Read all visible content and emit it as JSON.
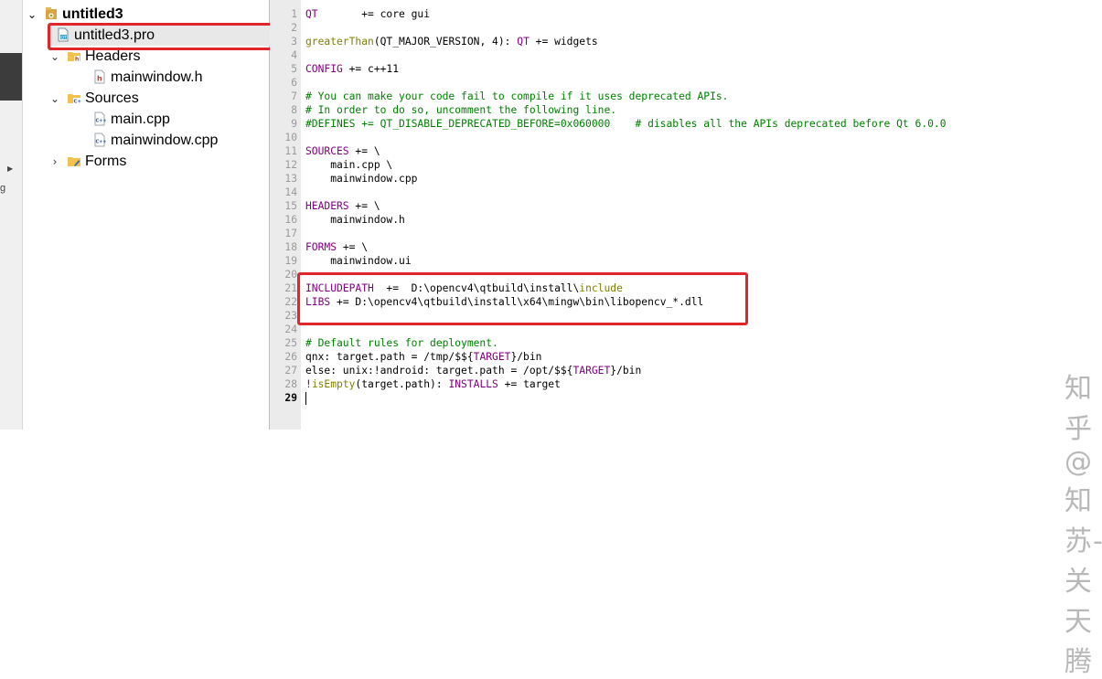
{
  "sidebar": {
    "g_label": "g"
  },
  "project_tree": {
    "root": "untitled3",
    "pro_file": "untitled3.pro",
    "headers_folder": "Headers",
    "header_file": "mainwindow.h",
    "sources_folder": "Sources",
    "source_main": "main.cpp",
    "source_mainwindow": "mainwindow.cpp",
    "forms_folder": "Forms"
  },
  "editor": {
    "lines": [
      {
        "n": "1",
        "segs": [
          {
            "t": "QT",
            "c": "kw"
          },
          {
            "t": "       += core gui"
          }
        ]
      },
      {
        "n": "2",
        "segs": []
      },
      {
        "n": "3",
        "segs": [
          {
            "t": "greaterThan",
            "c": "fn"
          },
          {
            "t": "(QT_MAJOR_VERSION, 4): "
          },
          {
            "t": "QT",
            "c": "kw"
          },
          {
            "t": " += widgets"
          }
        ]
      },
      {
        "n": "4",
        "segs": []
      },
      {
        "n": "5",
        "segs": [
          {
            "t": "CONFIG",
            "c": "kw"
          },
          {
            "t": " += c++11"
          }
        ]
      },
      {
        "n": "6",
        "segs": []
      },
      {
        "n": "7",
        "segs": [
          {
            "t": "# You can make your code fail to compile if it uses deprecated APIs.",
            "c": "cm"
          }
        ]
      },
      {
        "n": "8",
        "segs": [
          {
            "t": "# In order to do so, uncomment the following line.",
            "c": "cm"
          }
        ]
      },
      {
        "n": "9",
        "segs": [
          {
            "t": "#DEFINES += QT_DISABLE_DEPRECATED_BEFORE=0x060000    # disables all the APIs deprecated before Qt 6.0.0",
            "c": "cm"
          }
        ]
      },
      {
        "n": "10",
        "segs": []
      },
      {
        "n": "11",
        "segs": [
          {
            "t": "SOURCES",
            "c": "kw"
          },
          {
            "t": " += \\"
          }
        ]
      },
      {
        "n": "12",
        "segs": [
          {
            "t": "    main.cpp \\"
          }
        ]
      },
      {
        "n": "13",
        "segs": [
          {
            "t": "    mainwindow.cpp"
          }
        ]
      },
      {
        "n": "14",
        "segs": []
      },
      {
        "n": "15",
        "segs": [
          {
            "t": "HEADERS",
            "c": "kw"
          },
          {
            "t": " += \\"
          }
        ]
      },
      {
        "n": "16",
        "segs": [
          {
            "t": "    mainwindow.h"
          }
        ]
      },
      {
        "n": "17",
        "segs": []
      },
      {
        "n": "18",
        "segs": [
          {
            "t": "FORMS",
            "c": "kw"
          },
          {
            "t": " += \\"
          }
        ]
      },
      {
        "n": "19",
        "segs": [
          {
            "t": "    mainwindow.ui"
          }
        ]
      },
      {
        "n": "20",
        "segs": []
      },
      {
        "n": "21",
        "segs": [
          {
            "t": "INCLUDEPATH",
            "c": "kw"
          },
          {
            "t": "  +=  D:\\opencv4\\qtbuild\\install\\"
          },
          {
            "t": "include",
            "c": "fn"
          }
        ]
      },
      {
        "n": "22",
        "segs": [
          {
            "t": "LIBS",
            "c": "kw"
          },
          {
            "t": " += D:\\opencv4\\qtbuild\\install\\x64\\mingw\\bin\\libopencv_*.dll"
          }
        ]
      },
      {
        "n": "23",
        "segs": []
      },
      {
        "n": "24",
        "segs": []
      },
      {
        "n": "25",
        "segs": [
          {
            "t": "# Default rules for deployment.",
            "c": "cm"
          }
        ]
      },
      {
        "n": "26",
        "segs": [
          {
            "t": "qnx: target.path = /tmp/$${"
          },
          {
            "t": "TARGET",
            "c": "kw"
          },
          {
            "t": "}/bin"
          }
        ]
      },
      {
        "n": "27",
        "segs": [
          {
            "t": "else: unix:!android: target.path = /opt/$${"
          },
          {
            "t": "TARGET",
            "c": "kw"
          },
          {
            "t": "}/bin"
          }
        ]
      },
      {
        "n": "28",
        "segs": [
          {
            "t": "!",
            "c": "kw"
          },
          {
            "t": "isEmpty",
            "c": "fn"
          },
          {
            "t": "(target.path): "
          },
          {
            "t": "INSTALLS",
            "c": "kw"
          },
          {
            "t": " += target"
          }
        ]
      },
      {
        "n": "29",
        "segs": [],
        "current": true
      }
    ]
  },
  "watermark": "知乎 @知苏-关天腾",
  "colors": {
    "highlight_box": "#e0262b",
    "keyword": "#800080",
    "comment": "#008000",
    "function": "#808000"
  }
}
